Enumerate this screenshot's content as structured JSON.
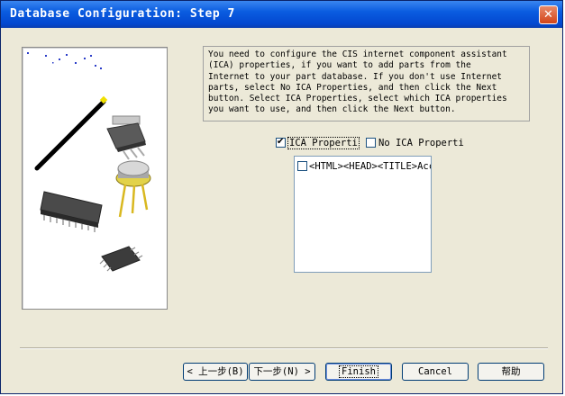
{
  "window": {
    "title": "Database Configuration: Step 7",
    "close_label": "✕"
  },
  "info": {
    "lines": [
      "You need to configure the CIS internet component assistant",
      "(ICA) properties, if you want to add parts from the",
      "Internet to your part database. If you don't use Internet",
      "parts, select No ICA Properties, and then click the Next",
      "button. Select ICA Properties, select which ICA properties",
      "you want to use, and then click the Next button."
    ]
  },
  "options": {
    "ica_properties": {
      "label": "ICA Properti",
      "checked": true
    },
    "no_ica_properties": {
      "label": "No ICA Properti",
      "checked": false
    }
  },
  "list": {
    "items": [
      {
        "label": "<HTML><HEAD><TITLE>Acce",
        "checked": false
      }
    ]
  },
  "buttons": {
    "back": "< 上一步(B)",
    "next": "下一步(N) >",
    "finish": "Finish",
    "cancel": "Cancel",
    "help": "帮助"
  },
  "colors": {
    "titlebar": "#0a5ce0",
    "dialog_bg": "#ece9d8"
  },
  "icons": {
    "illustration": "electronic-components-with-wand"
  }
}
